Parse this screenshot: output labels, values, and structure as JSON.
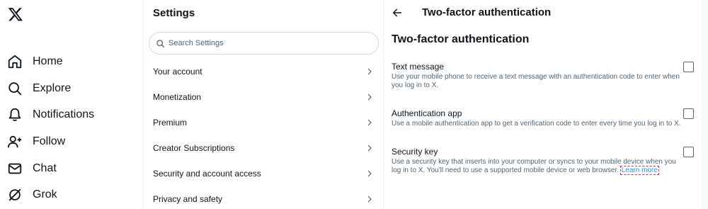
{
  "nav": {
    "items": [
      {
        "label": "Home",
        "icon": "home-icon"
      },
      {
        "label": "Explore",
        "icon": "search-icon"
      },
      {
        "label": "Notifications",
        "icon": "bell-icon"
      },
      {
        "label": "Follow",
        "icon": "follow-icon"
      },
      {
        "label": "Chat",
        "icon": "mail-icon"
      },
      {
        "label": "Grok",
        "icon": "grok-icon"
      }
    ]
  },
  "settings": {
    "title": "Settings",
    "search_placeholder": "Search Settings",
    "items": [
      {
        "label": "Your account"
      },
      {
        "label": "Monetization"
      },
      {
        "label": "Premium"
      },
      {
        "label": "Creator Subscriptions"
      },
      {
        "label": "Security and account access"
      },
      {
        "label": "Privacy and safety"
      }
    ]
  },
  "detail": {
    "header": "Two-factor authentication",
    "section_title": "Two-factor authentication",
    "options": [
      {
        "title": "Text message",
        "desc": "Use your mobile phone to receive a text message with an authentication code to enter when you log in to X.",
        "checked": false
      },
      {
        "title": "Authentication app",
        "desc": "Use a mobile authentication app to get a verification code to enter every time you log in to X.",
        "checked": false
      },
      {
        "title": "Security key",
        "desc": "Use a security key that inserts into your computer or syncs to your mobile device when you log in to X. You'll need to use a supported mobile device or web browser.",
        "link": "Learn more",
        "checked": false
      }
    ]
  },
  "colors": {
    "accent": "#1d9bf0",
    "text": "#0f1419",
    "muted": "#536471",
    "border": "#eff3f4"
  }
}
